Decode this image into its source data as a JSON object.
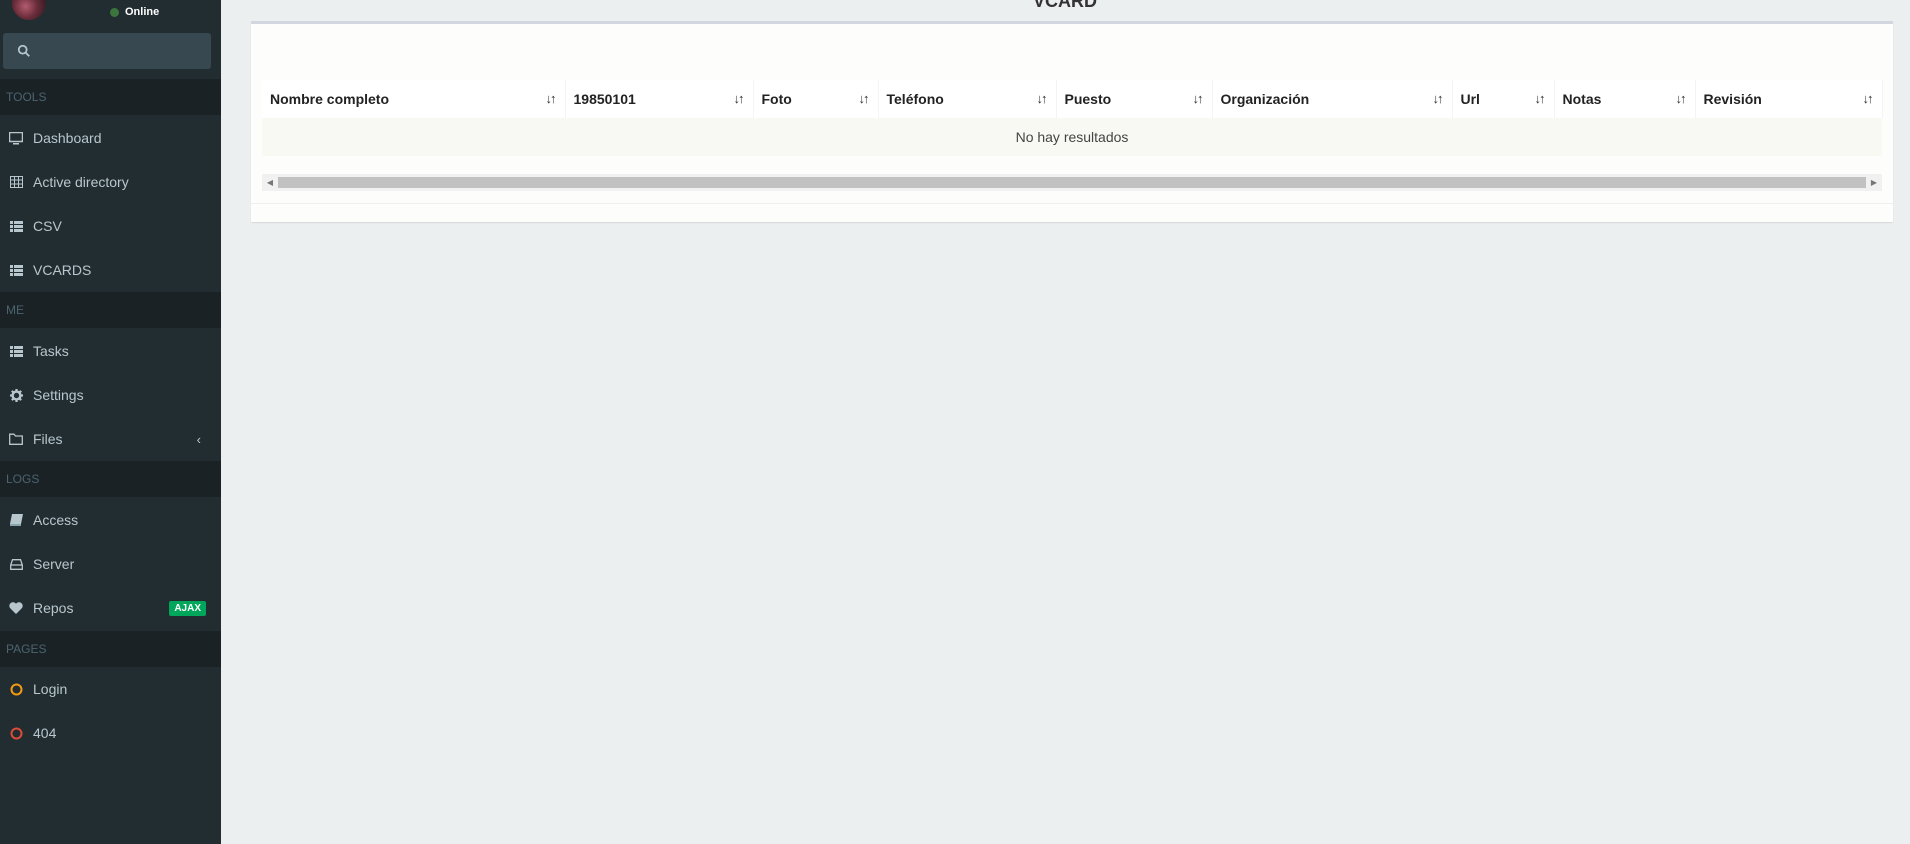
{
  "user": {
    "status": "Online"
  },
  "sidebar": {
    "sections": [
      {
        "title": "TOOLS"
      },
      {
        "title": "ME"
      },
      {
        "title": "LOGS"
      },
      {
        "title": "PAGES"
      }
    ],
    "items": [
      {
        "label": "Dashboard",
        "icon": "desktop-icon"
      },
      {
        "label": "Active directory",
        "icon": "table-icon"
      },
      {
        "label": "CSV",
        "icon": "list-icon"
      },
      {
        "label": "VCARDS",
        "icon": "list-icon"
      },
      {
        "label": "Tasks",
        "icon": "list-icon"
      },
      {
        "label": "Settings",
        "icon": "gear-icon"
      },
      {
        "label": "Files",
        "icon": "folder-icon"
      },
      {
        "label": "Access",
        "icon": "book-icon"
      },
      {
        "label": "Server",
        "icon": "hdd-icon"
      },
      {
        "label": "Repos",
        "icon": "heart-icon",
        "badge": "AJAX"
      },
      {
        "label": "Login",
        "icon": "circle-icon",
        "color": "#f39c12"
      },
      {
        "label": "404",
        "icon": "circle-icon",
        "color": "#dd4b39"
      }
    ]
  },
  "page": {
    "title": "VCARD"
  },
  "table": {
    "columns": [
      "Nombre completo",
      "19850101",
      "Foto",
      "Teléfono",
      "Puesto",
      "Organización",
      "Url",
      "Notas",
      "Revisión"
    ],
    "empty_message": "No hay resultados"
  }
}
